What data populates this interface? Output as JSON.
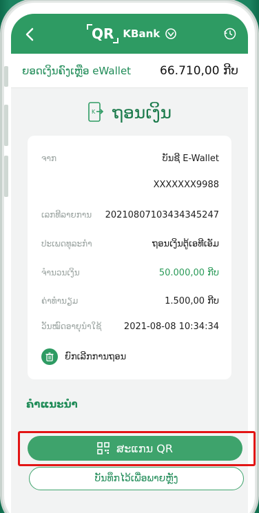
{
  "header": {
    "qr_text": "QR",
    "bank_name": "KBank"
  },
  "balance": {
    "label": "ຍອດເງິນຄົງເຫຼືອ eWallet",
    "value": "66.710,00 ກີບ"
  },
  "page_title": "ຖອນເງິນ",
  "details": {
    "from_label": "ຈາກ",
    "from_value": "ບັນຊີ E-Wallet",
    "account_value": "XXXXXXX9988",
    "txn_label": "ເລກທີລາຍການ",
    "txn_value": "20210807103434345247",
    "type_label": "ປະເພດທຸລະກຳ",
    "type_value": "ຖອນເງິນຕູ້ເອທີເອັມ",
    "amount_label": "ຈຳນວນເງິນ",
    "amount_value": "50.000,00  ກີບ",
    "fee_label": "ຄ່າທຳນຽມ",
    "fee_value": "1.500,00  ກີບ",
    "expiry_label": "ວັນໝົດອາຍຸນຳໃຊ້",
    "expiry_value": "2021-08-08 10:34:34",
    "cancel_label": "ຍົກເລີກການຖອນ"
  },
  "advice_label": "ຄຳແນະນຳ",
  "scan_button_label": "ສະແກນ QR",
  "save_button_label": "ບັນທຶກໄວ້ເພື່ອພາຍຫຼັງ",
  "colors": {
    "brand_green": "#2e9b63",
    "highlight_red": "#e21414"
  }
}
